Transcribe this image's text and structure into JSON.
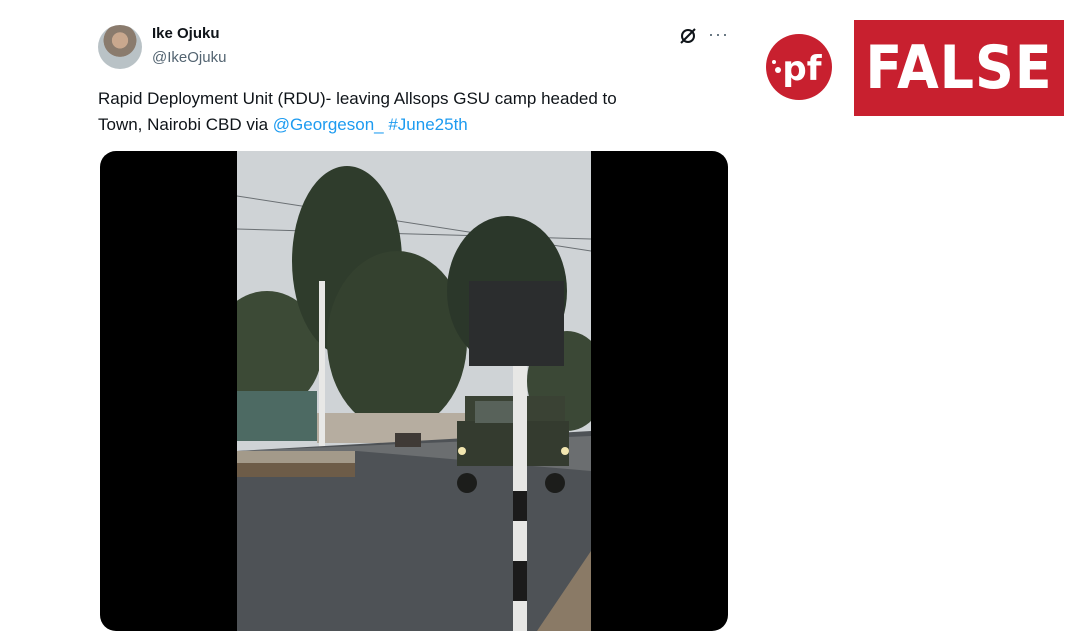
{
  "tweet": {
    "name": "Ike Ojuku",
    "handle": "@IkeOjuku",
    "text_line1": "Rapid Deployment Unit (RDU)- leaving Allsops GSU camp headed to",
    "text_line2_prefix": "Town, Nairobi CBD via ",
    "mention": "@Georgeson_",
    "hashtag": "#June25th",
    "more_icon": "more-dots-icon",
    "grok_icon": "grok-icon"
  },
  "verdict": {
    "logo_text": "pf",
    "label": "FALSE",
    "color": "#c8202f"
  }
}
